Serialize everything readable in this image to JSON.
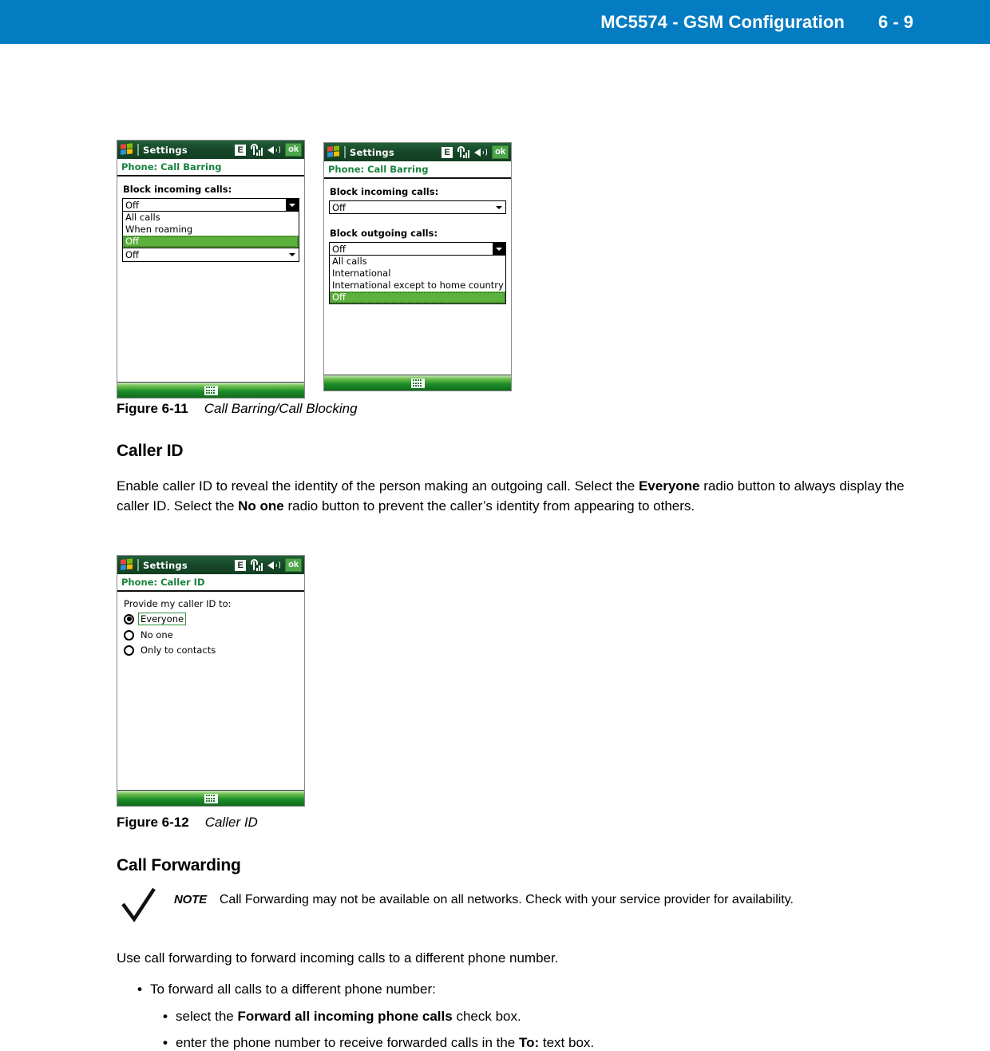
{
  "header": {
    "title": "MC5574 - GSM Configuration",
    "page_number": "6 - 9",
    "background_color": "#037cc2"
  },
  "devices": {
    "call_barring_incoming": {
      "titlebar": {
        "app_name": "Settings",
        "status_icons": [
          "windows-logo",
          "edge-E",
          "signal-bars",
          "speaker",
          "ok"
        ],
        "edge_label": "E",
        "ok_label": "ok"
      },
      "subtitle": "Phone: Call Barring",
      "field_label": "Block incoming calls:",
      "combo_value": "Off",
      "dropdown_options": [
        "All calls",
        "When roaming",
        "Off"
      ],
      "dropdown_selected": "Off",
      "collapsed_value": "Off",
      "taskbar_icon": "keyboard-icon"
    },
    "call_barring_outgoing": {
      "titlebar": {
        "app_name": "Settings",
        "edge_label": "E",
        "ok_label": "ok"
      },
      "subtitle": "Phone: Call Barring",
      "field_label_incoming": "Block incoming calls:",
      "combo_value_incoming": "Off",
      "field_label_outgoing": "Block outgoing calls:",
      "combo_value_outgoing": "Off",
      "dropdown_options": [
        "All calls",
        "International",
        "International except to home country",
        "Off"
      ],
      "dropdown_selected": "Off",
      "taskbar_icon": "keyboard-icon"
    },
    "caller_id": {
      "titlebar": {
        "app_name": "Settings",
        "edge_label": "E",
        "ok_label": "ok"
      },
      "subtitle": "Phone: Caller ID",
      "field_label": "Provide my caller ID to:",
      "radio_options": [
        {
          "label": "Everyone",
          "selected": true
        },
        {
          "label": "No one",
          "selected": false
        },
        {
          "label": "Only to contacts",
          "selected": false
        }
      ],
      "taskbar_icon": "keyboard-icon"
    }
  },
  "figures": {
    "fig_6_11": {
      "number": "Figure 6-11",
      "caption": "Call Barring/Call Blocking"
    },
    "fig_6_12": {
      "number": "Figure 6-12",
      "caption": "Caller ID"
    }
  },
  "sections": {
    "caller_id": {
      "heading": "Caller ID",
      "paragraph_line1_a": "Enable caller ID to reveal the identity of the person making an outgoing call. Select the ",
      "paragraph_line1_b": "Everyone",
      "paragraph_line1_c": " radio button to",
      "paragraph_line2_a": "always display the caller ID. Select the ",
      "paragraph_line2_b": "No one",
      "paragraph_line2_c": " radio button to prevent the caller’s identity from appearing to",
      "paragraph_line3": "others."
    },
    "call_forwarding": {
      "heading": "Call Forwarding",
      "note_label": "NOTE",
      "note_text": "Call Forwarding may not be available on all networks. Check with your service provider for availability.",
      "intro": "Use call forwarding to forward incoming calls to a different phone number.",
      "bullets": [
        {
          "level": 1,
          "text": "To forward all calls to a different phone number:"
        },
        {
          "level": 2,
          "text_a": "select the ",
          "bold": "Forward all incoming phone calls",
          "text_b": " check box."
        },
        {
          "level": 2,
          "text_a": "enter the phone number to receive forwarded calls in the ",
          "bold": "To:",
          "text_b": " text box."
        }
      ]
    }
  }
}
